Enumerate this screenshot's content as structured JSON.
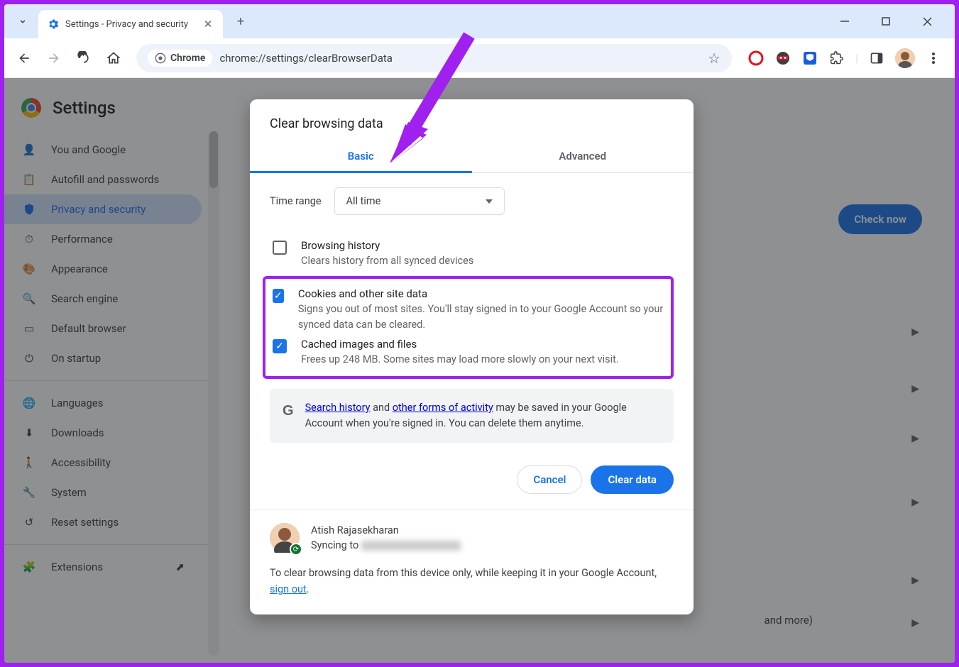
{
  "window": {
    "tab_title": "Settings - Privacy and security"
  },
  "toolbar": {
    "chip_label": "Chrome",
    "url": "chrome://settings/clearBrowserData"
  },
  "sidebar": {
    "title": "Settings",
    "items": [
      "You and Google",
      "Autofill and passwords",
      "Privacy and security",
      "Performance",
      "Appearance",
      "Search engine",
      "Default browser",
      "On startup"
    ],
    "items2": [
      "Languages",
      "Downloads",
      "Accessibility",
      "System",
      "Reset settings"
    ],
    "ext": "Extensions"
  },
  "bg": {
    "check_now": "Check now",
    "safety_trailing": "and more)"
  },
  "dialog": {
    "title": "Clear browsing data",
    "tabs": {
      "basic": "Basic",
      "advanced": "Advanced"
    },
    "timerange_label": "Time range",
    "timerange_value": "All time",
    "items": {
      "history": {
        "title": "Browsing history",
        "desc": "Clears history from all synced devices"
      },
      "cookies": {
        "title": "Cookies and other site data",
        "desc": "Signs you out of most sites. You'll stay signed in to your Google Account so your synced data can be cleared."
      },
      "cache": {
        "title": "Cached images and files",
        "desc": "Frees up 248 MB. Some sites may load more slowly on your next visit."
      }
    },
    "info": {
      "link1": "Search history",
      "mid": " and ",
      "link2": "other forms of activity",
      "rest": " may be saved in your Google Account when you're signed in. You can delete them anytime."
    },
    "cancel": "Cancel",
    "clear": "Clear data",
    "sync": {
      "name": "Atish Rajasekharan",
      "syncing": "Syncing to "
    },
    "footer": {
      "text1": "To clear browsing data from this device only, while keeping it in your Google Account, ",
      "link": "sign out",
      "text2": "."
    }
  }
}
